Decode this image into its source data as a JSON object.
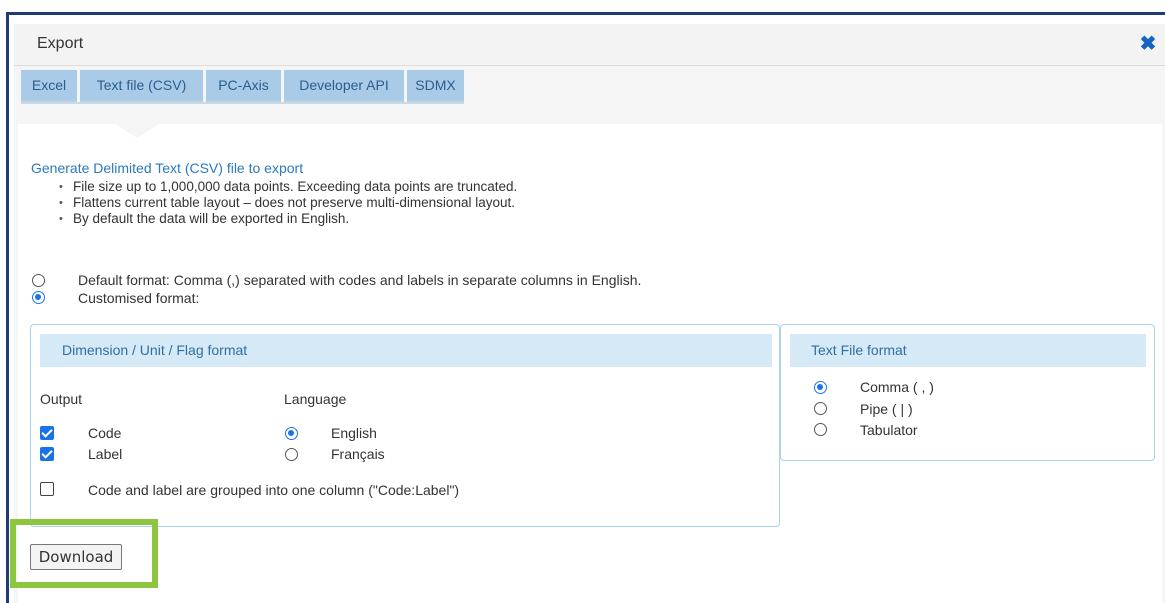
{
  "dialog": {
    "title": "Export",
    "close_icon": "close-icon"
  },
  "tabs": [
    {
      "label": "Excel"
    },
    {
      "label": "Text file (CSV)",
      "active": true
    },
    {
      "label": "PC-Axis"
    },
    {
      "label": "Developer API"
    },
    {
      "label": "SDMX"
    }
  ],
  "csv": {
    "heading": "Generate Delimited Text (CSV) file to export",
    "bullets": [
      "File size up to 1,000,000 data points. Exceeding data points are truncated.",
      "Flattens current table layout – does not preserve multi-dimensional layout.",
      "By default the data will be exported in English."
    ],
    "format_options": [
      {
        "label": "Default format: Comma (,) separated with codes and labels in separate columns in English.",
        "checked": false
      },
      {
        "label": "Customised format:",
        "checked": true
      }
    ]
  },
  "dimension_panel": {
    "title": "Dimension / Unit / Flag format",
    "output_label": "Output",
    "language_label": "Language",
    "output_options": [
      {
        "label": "Code",
        "checked": true
      },
      {
        "label": "Label",
        "checked": true
      }
    ],
    "language_options": [
      {
        "label": "English",
        "checked": true
      },
      {
        "label": "Français",
        "checked": false
      }
    ],
    "grouped_option": {
      "label": "Code and label are grouped into one column (\"Code:Label\")",
      "checked": false
    }
  },
  "text_file_panel": {
    "title": "Text File format",
    "options": [
      {
        "label": "Comma ( , )",
        "checked": true
      },
      {
        "label": "Pipe ( | )",
        "checked": false
      },
      {
        "label": "Tabulator",
        "checked": false
      }
    ]
  },
  "download_label": "Download",
  "colors": {
    "accent": "#1a73e8",
    "heading_blue": "#2c7ab8",
    "tab_bg": "#a9cbe8",
    "highlight_green": "#8cc63f",
    "frame_navy": "#1f3b73"
  }
}
